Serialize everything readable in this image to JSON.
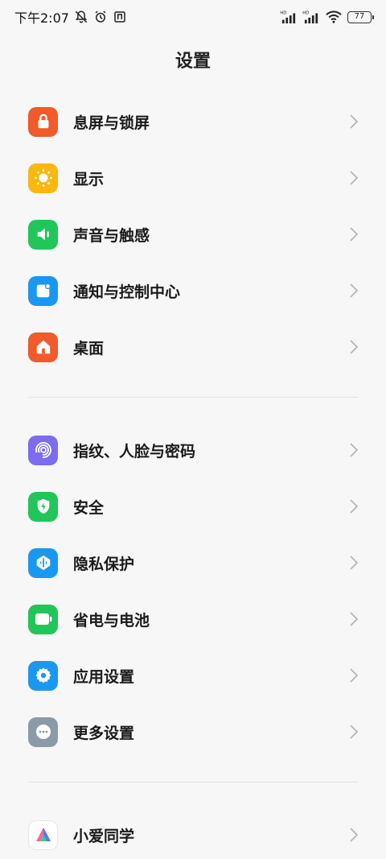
{
  "status_bar": {
    "time": "下午2:07",
    "battery": "77",
    "signal1_tag": "HD",
    "signal2_tag": "HD"
  },
  "header": {
    "title": "设置"
  },
  "groups": [
    {
      "items": [
        {
          "label": "息屏与锁屏",
          "icon": "lock-icon",
          "color": "#f15a2a"
        },
        {
          "label": "显示",
          "icon": "sun-icon",
          "color": "#fbb710"
        },
        {
          "label": "声音与触感",
          "icon": "speaker-icon",
          "color": "#20c659"
        },
        {
          "label": "通知与控制中心",
          "icon": "notification-icon",
          "color": "#1a98f0"
        },
        {
          "label": "桌面",
          "icon": "home-icon",
          "color": "#f15a2a"
        }
      ]
    },
    {
      "items": [
        {
          "label": "指纹、人脸与密码",
          "icon": "fingerprint-icon",
          "color": "#7b6cf0"
        },
        {
          "label": "安全",
          "icon": "shield-icon",
          "color": "#20c659"
        },
        {
          "label": "隐私保护",
          "icon": "privacy-icon",
          "color": "#1a98f0"
        },
        {
          "label": "省电与电池",
          "icon": "battery-icon",
          "color": "#20c659"
        },
        {
          "label": "应用设置",
          "icon": "gear-icon",
          "color": "#1a98f0"
        },
        {
          "label": "更多设置",
          "icon": "more-icon",
          "color": "#8a9aa8"
        }
      ]
    },
    {
      "items": [
        {
          "label": "小爱同学",
          "icon": "xiaoai-icon",
          "color": "#ffffff"
        }
      ]
    }
  ]
}
